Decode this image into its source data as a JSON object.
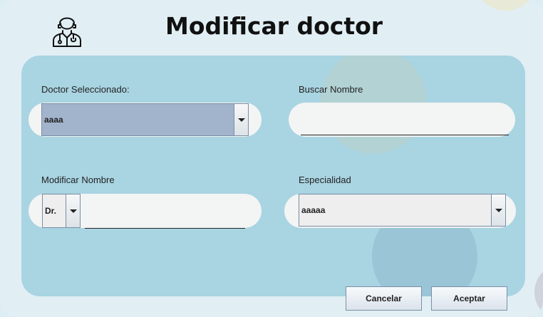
{
  "header": {
    "title": "Modificar doctor",
    "icon": "doctor-icon"
  },
  "form": {
    "doctor_selected": {
      "label": "Doctor Seleccionado:",
      "value": "aaaa"
    },
    "search_name": {
      "label": "Buscar Nombre",
      "value": ""
    },
    "modify_name": {
      "label": "Modificar Nombre",
      "prefix_value": "Dr.",
      "value": ""
    },
    "specialty": {
      "label": "Especialidad",
      "value": "aaaaa"
    }
  },
  "buttons": {
    "cancel": "Cancelar",
    "accept": "Aceptar"
  },
  "colors": {
    "background": "#e1eff4",
    "panel": "#a9d4e2",
    "selected_combo": "#a2b4cc",
    "combo": "#eeeeee"
  }
}
